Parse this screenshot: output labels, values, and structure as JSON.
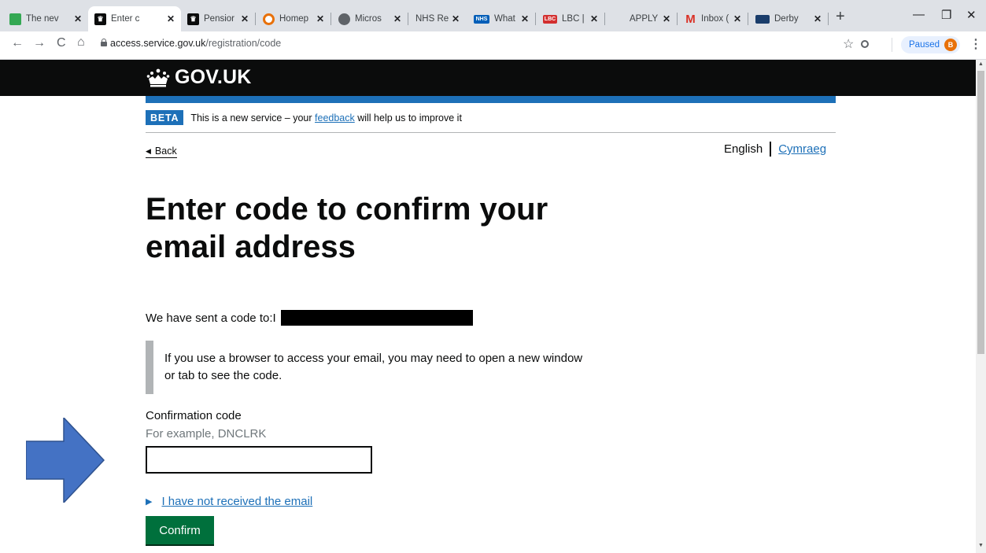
{
  "browser": {
    "tabs": [
      {
        "title": "The nev",
        "favicon": "leaf-icon",
        "color": "#34a853"
      },
      {
        "title": "Enter c",
        "favicon": "govuk-crown-icon",
        "color": "#0b0c0c"
      },
      {
        "title": "Pensior",
        "favicon": "govuk-crown-icon",
        "color": "#0b0c0c"
      },
      {
        "title": "Homep",
        "favicon": "circle-o-icon",
        "color": "#e8710a"
      },
      {
        "title": "Micros",
        "favicon": "globe-icon",
        "color": "#5f6368"
      },
      {
        "title": "NHS Re",
        "favicon": "",
        "color": "#dee1e6"
      },
      {
        "title": "What is",
        "favicon": "nhs-icon",
        "color": "#005eb8"
      },
      {
        "title": "LBC | L",
        "favicon": "lbc-icon",
        "color": "#d32f2f"
      },
      {
        "title": "APPLY",
        "favicon": "",
        "color": "#dee1e6"
      },
      {
        "title": "Inbox (",
        "favicon": "gmail-icon",
        "color": "#d93025"
      },
      {
        "title": "Derby",
        "favicon": "derby-icon",
        "color": "#1a3d6b"
      }
    ],
    "close_glyph": "✕",
    "new_tab": "+",
    "window_controls": {
      "minimize": "—",
      "restore": "❐",
      "close": "✕"
    },
    "nav": {
      "back": "←",
      "forward": "→",
      "reload": "C",
      "home": "⌂"
    },
    "url_host": "access.service.gov.uk",
    "url_path": "/registration/code",
    "star": "☆",
    "profile_status": "Paused",
    "profile_initial": "B",
    "menu": "⋮"
  },
  "header": {
    "logo_text": "GOV.UK"
  },
  "phase_banner": {
    "tag": "BETA",
    "text_before": "This is a new service – your ",
    "link": "feedback",
    "text_after": " will help us to improve it"
  },
  "back_link": {
    "arrow": "◀",
    "label": "Back"
  },
  "language": {
    "current": "English",
    "other": "Cymraeg"
  },
  "main": {
    "title": "Enter code to confirm your email address",
    "sent_text": "We have sent a code to: ",
    "sent_visible_char": "I",
    "inset_text": "If you use a browser to access your email, you may need to open a new window or tab to see the code.",
    "field_label": "Confirmation code",
    "hint": "For example, DNCLRK",
    "input_value": "",
    "details_arrow": "▶",
    "details_summary": "I have not received the email",
    "confirm_label": "Confirm"
  },
  "colors": {
    "govuk_black": "#0b0c0c",
    "govuk_blue": "#1d70b8",
    "button_green": "#00703c",
    "arrow_blue": "#4472c4"
  }
}
